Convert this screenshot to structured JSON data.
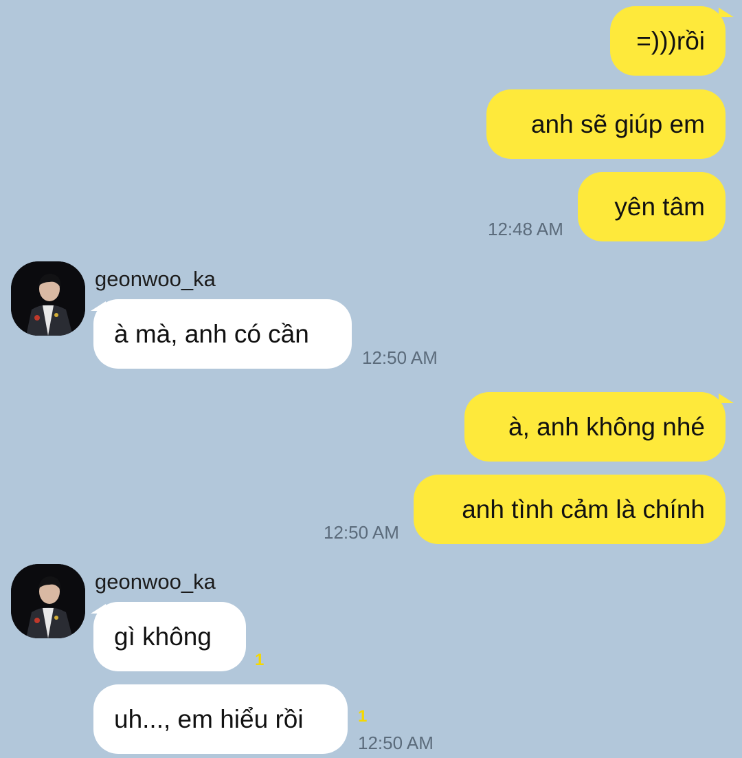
{
  "messages": {
    "m1": {
      "text": "=)))rồi"
    },
    "m2": {
      "text": "anh sẽ giúp em"
    },
    "m3": {
      "text": "yên tâm",
      "time": "12:48 AM"
    },
    "m4": {
      "sender": "geonwoo_ka",
      "text": "à mà, anh có cần",
      "time": "12:50 AM"
    },
    "m5": {
      "text": "à, anh không nhé"
    },
    "m6": {
      "text": "anh tình cảm là chính",
      "time": "12:50 AM"
    },
    "m7": {
      "sender": "geonwoo_ka",
      "text": "gì không",
      "unread": "1"
    },
    "m8": {
      "text": "uh..., em hiểu rồi",
      "unread": "1",
      "time": "12:50 AM"
    }
  },
  "colors": {
    "background": "#b2c7da",
    "my_bubble": "#fee93b",
    "their_bubble": "#ffffff",
    "unread": "#f5d800"
  },
  "icons": {
    "avatar": "profile-photo"
  }
}
